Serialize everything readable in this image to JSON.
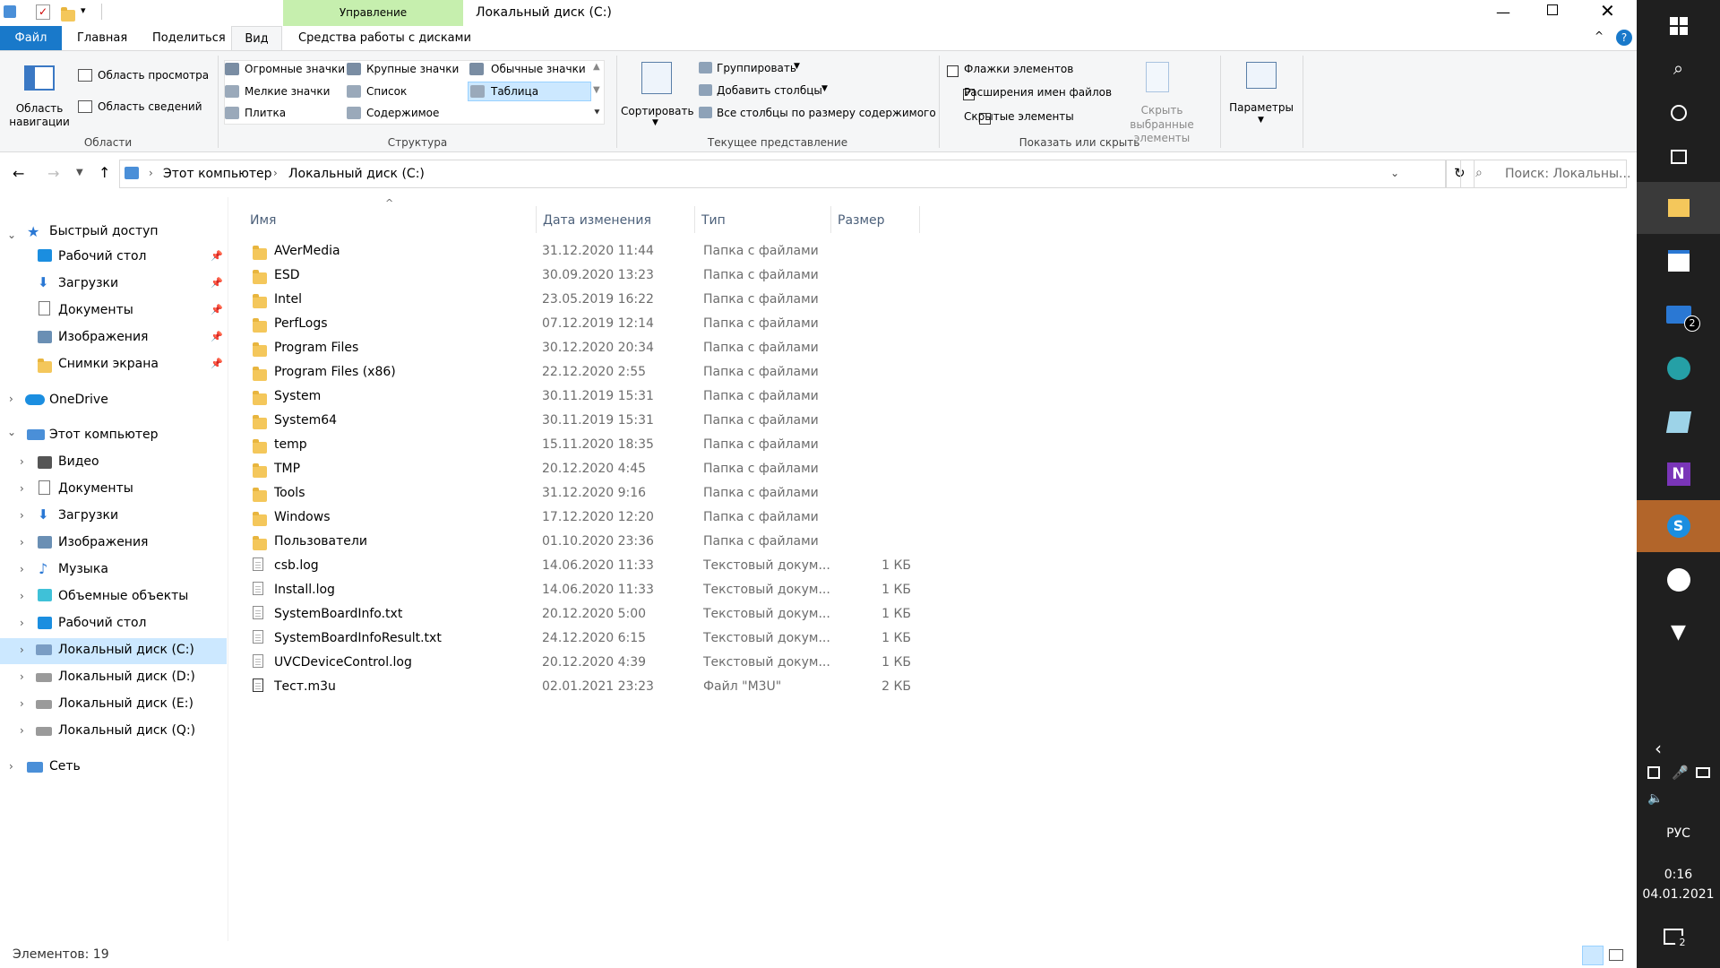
{
  "window": {
    "title": "Локальный диск (C:)",
    "context_tab_header": "Управление"
  },
  "ribbon_tabs": [
    {
      "label": "Файл"
    },
    {
      "label": "Главная"
    },
    {
      "label": "Поделиться"
    },
    {
      "label": "Вид"
    },
    {
      "label": "Средства работы с дисками"
    }
  ],
  "ribbon": {
    "areas": {
      "nav_pane_label": "Область навигации",
      "preview_pane": "Область просмотра",
      "details_pane": "Область сведений",
      "group_label": "Области"
    },
    "layout": {
      "items": [
        "Огромные значки",
        "Крупные значки",
        "Обычные значки",
        "Мелкие значки",
        "Список",
        "Таблица",
        "Плитка",
        "Содержимое"
      ],
      "group_label": "Структура"
    },
    "current_view": {
      "sort_label": "Сортировать",
      "group_by": "Группировать",
      "add_columns": "Добавить столбцы",
      "size_all_columns": "Все столбцы по размеру содержимого",
      "group_label": "Текущее представление"
    },
    "show_hide": {
      "item_checkboxes": "Флажки элементов",
      "file_extensions": "Расширения имен файлов",
      "hidden_items": "Скрытые элементы",
      "hide_selected": "Скрыть выбранные элементы",
      "group_label": "Показать или скрыть",
      "item_checkboxes_checked": false,
      "file_extensions_checked": true,
      "hidden_items_checked": false
    },
    "options_label": "Параметры"
  },
  "address": {
    "crumbs": [
      "Этот компьютер",
      "Локальный диск (C:)"
    ],
    "search_placeholder": "Поиск: Локальны..."
  },
  "nav": {
    "quick_access": "Быстрый доступ",
    "quick_items": [
      "Рабочий стол",
      "Загрузки",
      "Документы",
      "Изображения",
      "Снимки экрана"
    ],
    "onedrive": "OneDrive",
    "this_pc": "Этот компьютер",
    "pc_items": [
      "Видео",
      "Документы",
      "Загрузки",
      "Изображения",
      "Музыка",
      "Объемные объекты",
      "Рабочий стол",
      "Локальный диск (C:)",
      "Локальный диск (D:)",
      "Локальный диск (E:)",
      "Локальный диск (Q:)"
    ],
    "network": "Сеть"
  },
  "columns": [
    "Имя",
    "Дата изменения",
    "Тип",
    "Размер"
  ],
  "files": [
    {
      "name": "AVerMedia",
      "date": "31.12.2020 11:44",
      "type": "Папка с файлами",
      "size": "",
      "icon": "folder"
    },
    {
      "name": "ESD",
      "date": "30.09.2020 13:23",
      "type": "Папка с файлами",
      "size": "",
      "icon": "folder"
    },
    {
      "name": "Intel",
      "date": "23.05.2019 16:22",
      "type": "Папка с файлами",
      "size": "",
      "icon": "folder"
    },
    {
      "name": "PerfLogs",
      "date": "07.12.2019 12:14",
      "type": "Папка с файлами",
      "size": "",
      "icon": "folder"
    },
    {
      "name": "Program Files",
      "date": "30.12.2020 20:34",
      "type": "Папка с файлами",
      "size": "",
      "icon": "folder"
    },
    {
      "name": "Program Files (x86)",
      "date": "22.12.2020 2:55",
      "type": "Папка с файлами",
      "size": "",
      "icon": "folder"
    },
    {
      "name": "System",
      "date": "30.11.2019 15:31",
      "type": "Папка с файлами",
      "size": "",
      "icon": "folder"
    },
    {
      "name": "System64",
      "date": "30.11.2019 15:31",
      "type": "Папка с файлами",
      "size": "",
      "icon": "folder"
    },
    {
      "name": "temp",
      "date": "15.11.2020 18:35",
      "type": "Папка с файлами",
      "size": "",
      "icon": "folder"
    },
    {
      "name": "TMP",
      "date": "20.12.2020 4:45",
      "type": "Папка с файлами",
      "size": "",
      "icon": "folder"
    },
    {
      "name": "Tools",
      "date": "31.12.2020 9:16",
      "type": "Папка с файлами",
      "size": "",
      "icon": "folder"
    },
    {
      "name": "Windows",
      "date": "17.12.2020 12:20",
      "type": "Папка с файлами",
      "size": "",
      "icon": "folder"
    },
    {
      "name": "Пользователи",
      "date": "01.10.2020 23:36",
      "type": "Папка с файлами",
      "size": "",
      "icon": "folder"
    },
    {
      "name": "csb.log",
      "date": "14.06.2020 11:33",
      "type": "Текстовый докум...",
      "size": "1 КБ",
      "icon": "file"
    },
    {
      "name": "Install.log",
      "date": "14.06.2020 11:33",
      "type": "Текстовый докум...",
      "size": "1 КБ",
      "icon": "file"
    },
    {
      "name": "SystemBoardInfo.txt",
      "date": "20.12.2020 5:00",
      "type": "Текстовый докум...",
      "size": "1 КБ",
      "icon": "file"
    },
    {
      "name": "SystemBoardInfoResult.txt",
      "date": "24.12.2020 6:15",
      "type": "Текстовый докум...",
      "size": "1 КБ",
      "icon": "file"
    },
    {
      "name": "UVCDeviceControl.log",
      "date": "20.12.2020 4:39",
      "type": "Текстовый докум...",
      "size": "1 КБ",
      "icon": "file"
    },
    {
      "name": "Тест.m3u",
      "date": "02.01.2021 23:23",
      "type": "Файл \"M3U\"",
      "size": "2 КБ",
      "icon": "media"
    }
  ],
  "status": {
    "count": "Элементов: 19"
  },
  "taskbar": {
    "lang": "РУС",
    "time": "0:16",
    "date": "04.01.2021",
    "mail_badge": "2",
    "notif_badge": "2"
  },
  "colors": {
    "accent": "#1979ca",
    "context_tab": "#c6efae",
    "taskbar": "#1f1f1f",
    "selection": "#cce8ff"
  }
}
